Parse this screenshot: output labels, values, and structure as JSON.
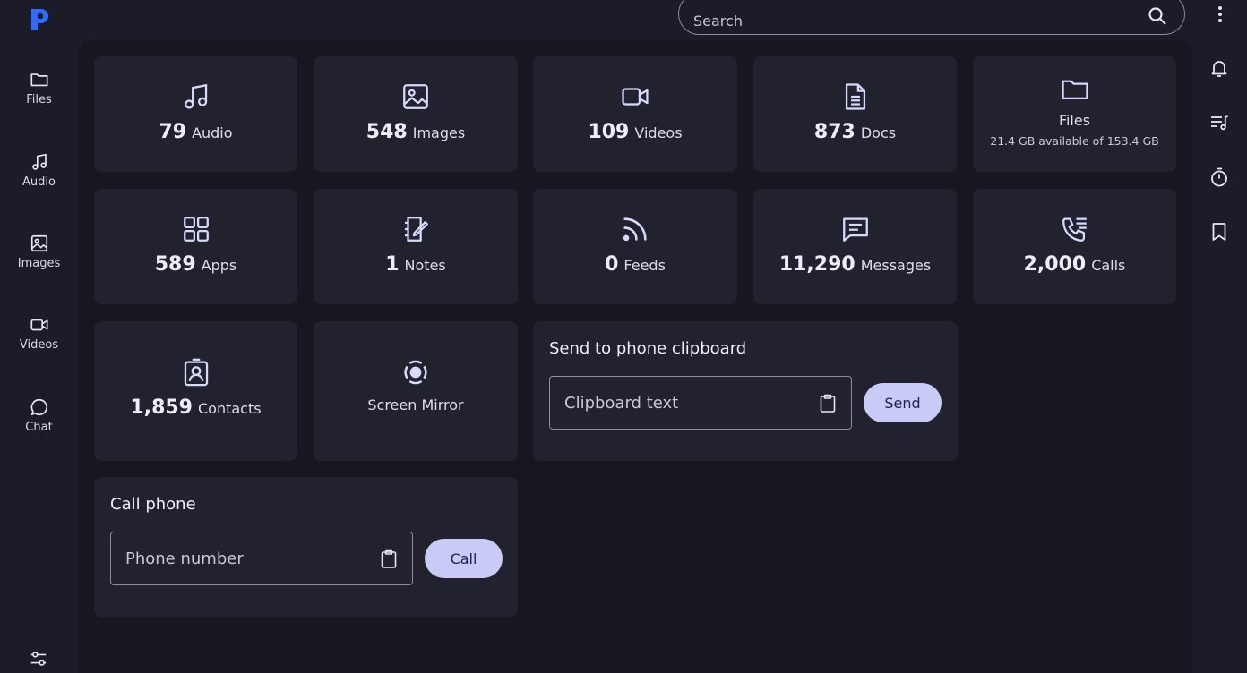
{
  "app": {
    "logo_letter": "P",
    "accent": "#2f6bff"
  },
  "search": {
    "placeholder": "Search"
  },
  "nav": [
    {
      "label": "Files",
      "icon": "folder-icon"
    },
    {
      "label": "Audio",
      "icon": "music-note-icon"
    },
    {
      "label": "Images",
      "icon": "image-icon"
    },
    {
      "label": "Videos",
      "icon": "video-camera-icon"
    },
    {
      "label": "Chat",
      "icon": "chat-bubble-icon"
    }
  ],
  "rail": [
    "bell-icon",
    "playlist-icon",
    "timer-icon",
    "bookmark-icon"
  ],
  "tiles": {
    "audio": {
      "count": "79",
      "label": "Audio"
    },
    "images": {
      "count": "548",
      "label": "Images"
    },
    "videos": {
      "count": "109",
      "label": "Videos"
    },
    "docs": {
      "count": "873",
      "label": "Docs"
    },
    "files": {
      "label": "Files",
      "storage": "21.4 GB available of 153.4 GB"
    },
    "apps": {
      "count": "589",
      "label": "Apps"
    },
    "notes": {
      "count": "1",
      "label": "Notes"
    },
    "feeds": {
      "count": "0",
      "label": "Feeds"
    },
    "messages": {
      "count": "11,290",
      "label": "Messages"
    },
    "calls": {
      "count": "2,000",
      "label": "Calls"
    },
    "contacts": {
      "count": "1,859",
      "label": "Contacts"
    },
    "screen_mirror": {
      "label": "Screen Mirror"
    }
  },
  "clipboard": {
    "title": "Send to phone clipboard",
    "placeholder": "Clipboard text",
    "button": "Send"
  },
  "call": {
    "title": "Call phone",
    "placeholder": "Phone number",
    "button": "Call"
  }
}
